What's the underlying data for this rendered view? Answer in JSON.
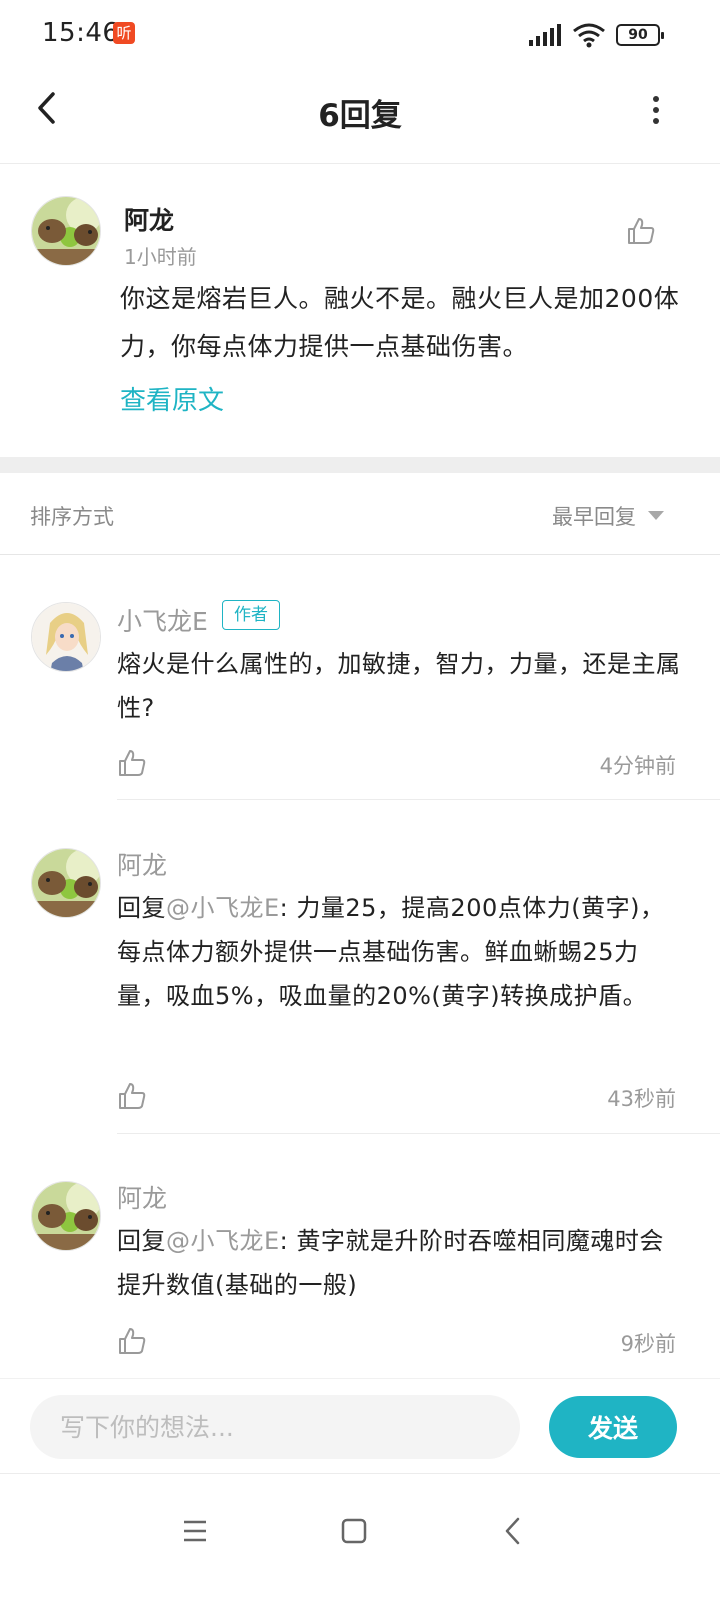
{
  "status_bar": {
    "time": "15:46",
    "app_badge": "听",
    "battery": "90"
  },
  "nav": {
    "title": "6回复"
  },
  "post": {
    "author": "阿龙",
    "time": "1小时前",
    "body": "你这是熔岩巨人。融火不是。融火巨人是加200体力，你每点体力提供一点基础伤害。",
    "original_link": "查看原文"
  },
  "sort": {
    "label": "排序方式",
    "value": "最早回复"
  },
  "replies": [
    {
      "author": "小飞龙E",
      "badge": "作者",
      "body": "熔火是什么属性的，加敏捷，智力，力量，还是主属性?",
      "time": "4分钟前"
    },
    {
      "author": "阿龙",
      "reply_prefix": "回复",
      "mention": "@小飞龙E",
      "body": ": 力量25，提高200点体力(黄字)，每点体力额外提供一点基础伤害。鲜血蜥蜴25力量，吸血5%，吸血量的20%(黄字)转换成护盾。",
      "time": "43秒前"
    },
    {
      "author": "阿龙",
      "reply_prefix": "回复",
      "mention": "@小飞龙E",
      "body": ": 黄字就是升阶时吞噬相同魔魂时会提升数值(基础的一般)",
      "time": "9秒前"
    }
  ],
  "input": {
    "placeholder": "写下你的想法...",
    "send_label": "发送"
  },
  "colors": {
    "accent": "#1fb4c4",
    "muted_text": "#9a9a9a",
    "section_gap": "#eeeeee"
  },
  "icons": {
    "back": "chevron-left-icon",
    "more": "more-vertical-icon",
    "like": "thumb-up-icon",
    "sort_caret": "caret-down-icon",
    "sys_menu": "menu-icon",
    "sys_home": "square-home-icon",
    "sys_back": "back-triangle-icon"
  }
}
